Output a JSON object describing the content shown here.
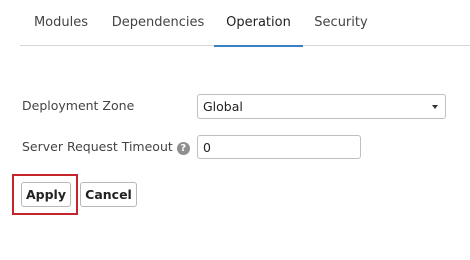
{
  "tabs": [
    {
      "label": "Modules"
    },
    {
      "label": "Dependencies"
    },
    {
      "label": "Operation"
    },
    {
      "label": "Security"
    }
  ],
  "active_tab": "Operation",
  "form": {
    "deployment_zone": {
      "label": "Deployment Zone",
      "value": "Global"
    },
    "server_request_timeout": {
      "label": "Server Request Timeout",
      "help_icon": "question-mark",
      "value": "0"
    }
  },
  "buttons": {
    "apply": "Apply",
    "cancel": "Cancel"
  },
  "colors": {
    "accent": "#3b7fc4",
    "highlight": "#c4242b"
  }
}
